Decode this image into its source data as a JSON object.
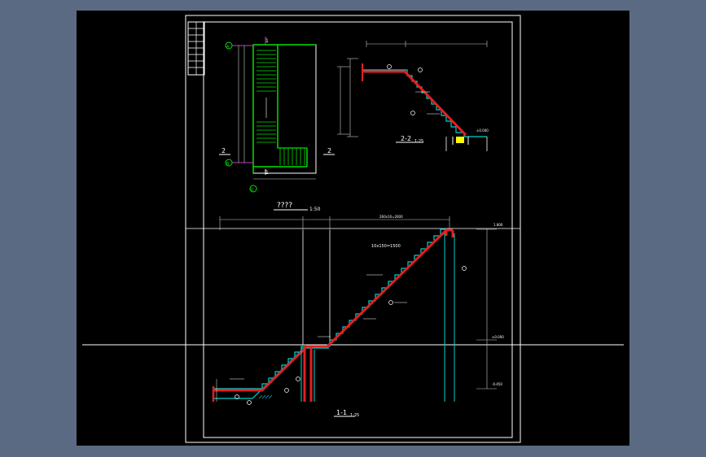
{
  "viewport": {
    "background": "#5a6a82",
    "canvas_background": "#000000"
  },
  "colors": {
    "frame": "#ffffff",
    "stairs": "#00d0d0",
    "rebar": "#e02020",
    "plan": "#00e000",
    "dimension": "#c8c8c8",
    "axis": "#c040c0",
    "label": "#ffff00"
  },
  "labels": {
    "plan_title": "????",
    "plan_scale": "1:50",
    "section_22_title": "2-2",
    "section_22_scale": "1:25",
    "section_11_title": "1-1",
    "section_11_scale": "1:25",
    "cut_mark_2": "2",
    "cut_mark_1": "1",
    "axis_a": "A",
    "axis_b": "B",
    "axis_c": "C",
    "section_22_note": "±0.000",
    "section_11_top_elev": "1.800",
    "section_11_mid_elev": "±0.000",
    "section_11_bot_elev": "-0.450",
    "section_11_flight_note": "10x150=1500",
    "section_11_upper_note": "260x10=2600"
  }
}
